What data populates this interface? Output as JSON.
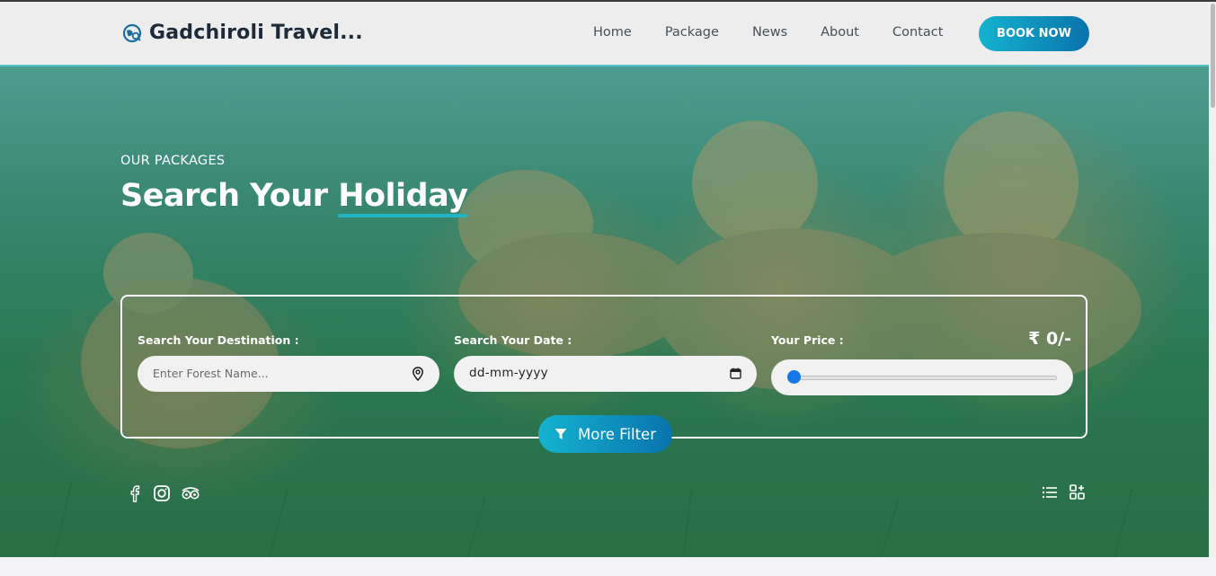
{
  "brand": {
    "name": "Gadchiroli Travel...",
    "logo_icon": "globe-search-icon"
  },
  "nav": {
    "links": [
      "Home",
      "Package",
      "News",
      "About",
      "Contact"
    ],
    "cta": "BOOK NOW"
  },
  "hero": {
    "subtitle": "OUR PACKAGES",
    "title_plain": "Search Your ",
    "title_highlight": "Holiday"
  },
  "search": {
    "destination_label": "Search Your Destination :",
    "destination_placeholder": "Enter Forest Name...",
    "date_label": "Search Your Date :",
    "date_value": "dd-mm-yyyy",
    "price_label": "Your Price :",
    "price_value": "₹ 0/-",
    "price_slider_fraction": 0.0,
    "more_filter": "More Filter"
  },
  "social_icons": [
    "facebook-icon",
    "instagram-icon",
    "tripadvisor-icon"
  ],
  "view_icons": [
    "list-view-icon",
    "grid-view-icon"
  ],
  "colors": {
    "accent_start": "#14b3cf",
    "accent_end": "#0a73ad",
    "slider_thumb": "#1677e8"
  }
}
